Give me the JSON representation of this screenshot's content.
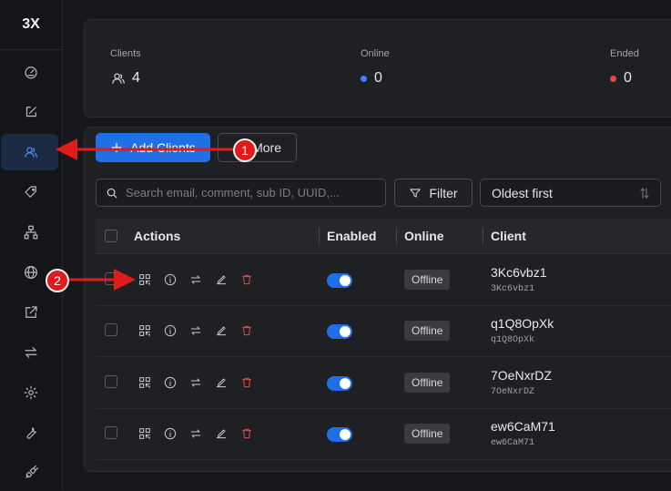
{
  "app": {
    "logo": "3X"
  },
  "sidebar": {
    "items": [
      {
        "name": "dashboard",
        "icon": "gauge-icon",
        "active": false
      },
      {
        "name": "inbounds",
        "icon": "edit-square-icon",
        "active": false
      },
      {
        "name": "clients",
        "icon": "users-icon",
        "active": true
      },
      {
        "name": "tags",
        "icon": "tag-icon",
        "active": false
      },
      {
        "name": "nodes",
        "icon": "sitemap-icon",
        "active": false
      },
      {
        "name": "network",
        "icon": "globe-icon",
        "active": false
      },
      {
        "name": "outbound",
        "icon": "external-link-icon",
        "active": false
      },
      {
        "name": "routing",
        "icon": "swap-arrows-icon",
        "active": false
      },
      {
        "name": "settings",
        "icon": "gear-icon",
        "active": false
      },
      {
        "name": "tools",
        "icon": "wrench-icon",
        "active": false
      },
      {
        "name": "plugin",
        "icon": "plug-icon",
        "active": false
      }
    ]
  },
  "stats": {
    "clients": {
      "label": "Clients",
      "value": "4"
    },
    "online": {
      "label": "Online",
      "value": "0",
      "color": "#3b82f6"
    },
    "ended": {
      "label": "Ended",
      "value": "0",
      "color": "#ef4444"
    }
  },
  "toolbar": {
    "add_label": "Add Clients",
    "more_label": "More",
    "search_placeholder": "Search email, comment, sub ID, UUID,...",
    "filter_label": "Filter",
    "sort_value": "Oldest first"
  },
  "table": {
    "headers": {
      "actions": "Actions",
      "enabled": "Enabled",
      "online": "Online",
      "client": "Client"
    },
    "rows": [
      {
        "email": "3Kc6vbz1",
        "sub": "3Kc6vbz1",
        "status": "Offline",
        "enabled": true
      },
      {
        "email": "q1Q8OpXk",
        "sub": "q1Q8OpXk",
        "status": "Offline",
        "enabled": true
      },
      {
        "email": "7OeNxrDZ",
        "sub": "7OeNxrDZ",
        "status": "Offline",
        "enabled": true
      },
      {
        "email": "ew6CaM71",
        "sub": "ew6CaM71",
        "status": "Offline",
        "enabled": true
      }
    ]
  },
  "annotations": {
    "callout1": "1",
    "callout2": "2",
    "color": "#e01b1b"
  }
}
